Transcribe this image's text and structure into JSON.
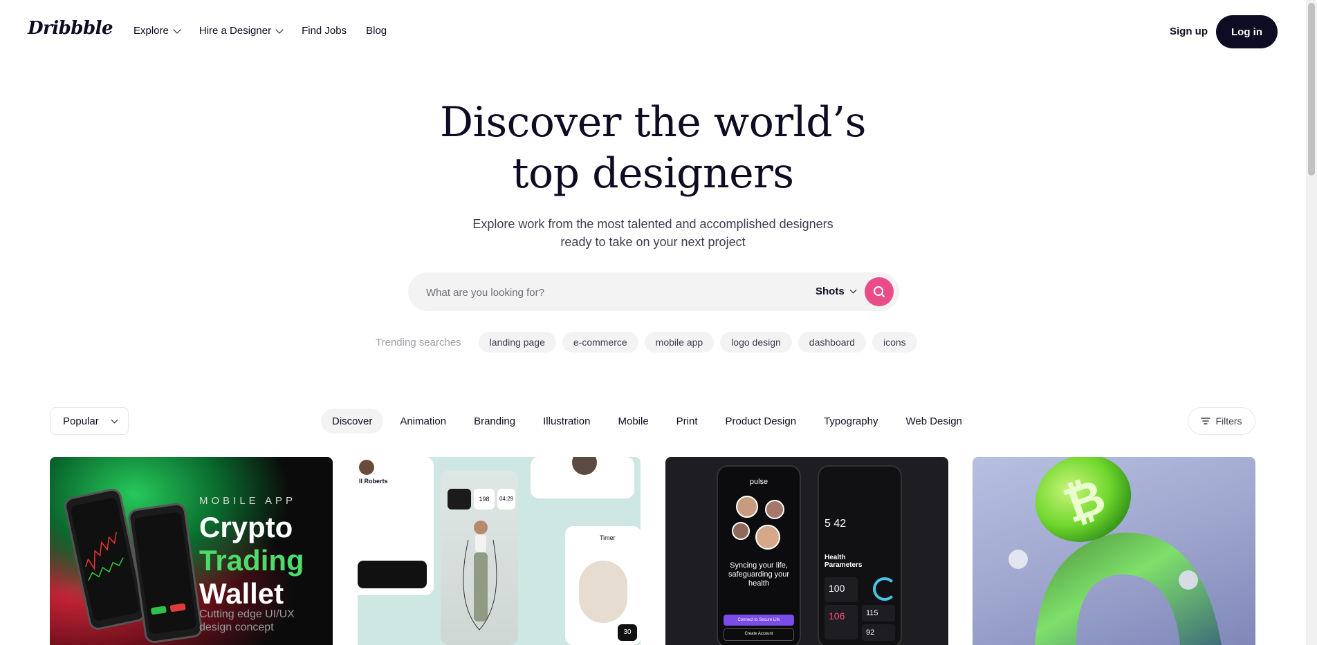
{
  "header": {
    "logo": "Dribbble",
    "nav": [
      "Explore",
      "Hire a Designer",
      "Find Jobs",
      "Blog"
    ],
    "signup": "Sign up",
    "login": "Log in"
  },
  "hero": {
    "title_line1": "Discover the world’s",
    "title_line2": "top designers",
    "subtitle_line1": "Explore work from the most talented and accomplished designers",
    "subtitle_line2": "ready to take on your next project"
  },
  "search": {
    "placeholder": "What are you looking for?",
    "type": "Shots",
    "button_icon": "search-icon"
  },
  "trending": {
    "label": "Trending searches",
    "chips": [
      "landing page",
      "e-commerce",
      "mobile app",
      "logo design",
      "dashboard",
      "icons"
    ]
  },
  "filterbar": {
    "sort": "Popular",
    "categories": [
      "Discover",
      "Animation",
      "Branding",
      "Illustration",
      "Mobile",
      "Print",
      "Product Design",
      "Typography",
      "Web Design"
    ],
    "active_category": "Discover",
    "filters_label": "Filters"
  },
  "shots": [
    {
      "kicker": "MOBILE APP",
      "line1": "Crypto",
      "line2": "Trading",
      "line3": "Wallet",
      "sub1": "Cutting edge UI/UX",
      "sub2": "design concept"
    },
    {
      "name_tag": "ll Roberts",
      "stat1": "198",
      "stat2": "04:29",
      "card_label": "Timer",
      "bottom_num": "30"
    },
    {
      "brand": "pulse",
      "headline": "Syncing your life, safeguarding your health",
      "cta1": "Connect to Secure Life",
      "cta2": "Create Account",
      "panel_title": "Health Parameters",
      "time": "5 42",
      "v1": "100",
      "v2": "106",
      "v3": "115",
      "v4": "92"
    },
    {}
  ],
  "colors": {
    "brand_pink": "#ea4c89",
    "ink": "#0d0c22",
    "chip_bg": "#f3f3f4",
    "crypto_green": "#4ddb6a"
  }
}
